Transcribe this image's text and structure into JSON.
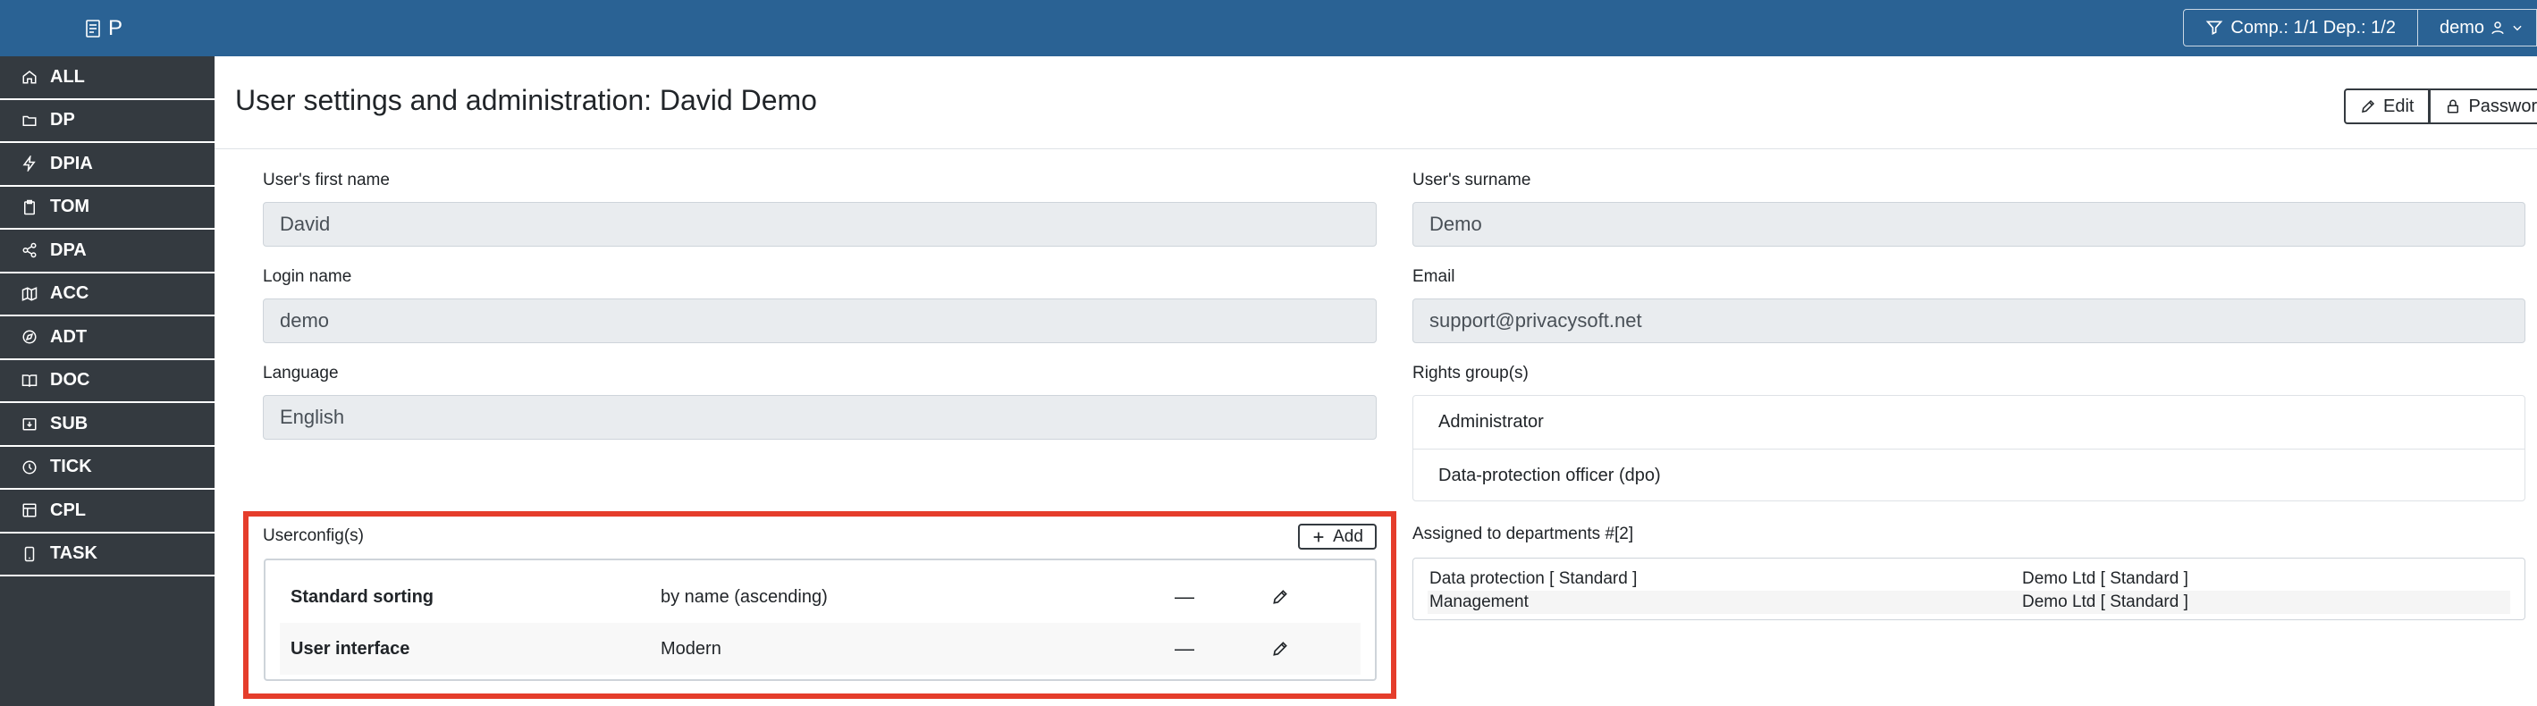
{
  "topbar": {
    "logo_text": "P",
    "filter_label": "Comp.: 1/1 Dep.: 1/2",
    "user_label": "demo"
  },
  "sidebar": {
    "items": [
      {
        "label": "ALL",
        "icon": "home-icon"
      },
      {
        "label": "DP",
        "icon": "folder-icon"
      },
      {
        "label": "DPIA",
        "icon": "lightning-icon"
      },
      {
        "label": "TOM",
        "icon": "clipboard-icon"
      },
      {
        "label": "DPA",
        "icon": "share-icon"
      },
      {
        "label": "ACC",
        "icon": "map-icon"
      },
      {
        "label": "ADT",
        "icon": "compass-icon"
      },
      {
        "label": "DOC",
        "icon": "book-icon"
      },
      {
        "label": "SUB",
        "icon": "download-box-icon"
      },
      {
        "label": "TICK",
        "icon": "clock-icon"
      },
      {
        "label": "CPL",
        "icon": "table-icon"
      },
      {
        "label": "TASK",
        "icon": "phone-icon"
      }
    ]
  },
  "page": {
    "title": "User settings and administration: David Demo",
    "edit_label": "Edit",
    "password_label": "Password"
  },
  "form": {
    "first_name_label": "User's first name",
    "first_name_value": "David",
    "surname_label": "User's surname",
    "surname_value": "Demo",
    "login_label": "Login name",
    "login_value": "demo",
    "email_label": "Email",
    "email_value": "support@privacysoft.net",
    "language_label": "Language",
    "language_value": "English",
    "rights_label": "Rights group(s)",
    "rights": [
      "Administrator",
      "Data-protection officer (dpo)"
    ],
    "departments_label": "Assigned to departments #[2]",
    "departments": [
      {
        "department": "Data protection [ Standard ]",
        "company": "Demo Ltd [ Standard ]"
      },
      {
        "department": "Management",
        "company": "Demo Ltd [ Standard ]"
      }
    ]
  },
  "userconfig": {
    "label": "Userconfig(s)",
    "add_label": "Add",
    "rows": [
      {
        "name": "Standard sorting",
        "value": "by name (ascending)",
        "dash": "—"
      },
      {
        "name": "User interface",
        "value": "Modern",
        "dash": "—"
      }
    ]
  },
  "colors": {
    "topbar": "#2a6294",
    "sidebar": "#343a40",
    "highlight": "#e53d2b"
  }
}
